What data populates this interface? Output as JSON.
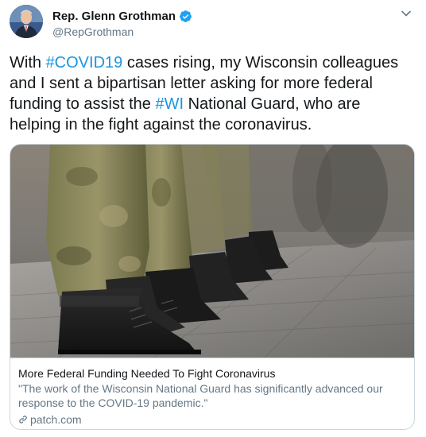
{
  "author": {
    "name": "Rep. Glenn Grothman",
    "handle": "@RepGrothman",
    "verified": true
  },
  "tweet": {
    "text_parts": [
      {
        "text": "With ",
        "type": "text"
      },
      {
        "text": "#COVID19",
        "type": "hashtag"
      },
      {
        "text": " cases rising, my Wisconsin colleagues and I sent a bipartisan letter asking for more federal funding to assist the ",
        "type": "text"
      },
      {
        "text": "#WI",
        "type": "hashtag"
      },
      {
        "text": " National Guard, who are helping in the fight against the coronavirus.",
        "type": "text"
      }
    ]
  },
  "card": {
    "title": "More Federal Funding Needed To Fight Coronavirus",
    "description": "\"The work of the Wisconsin National Guard has significantly advanced our response to the COVID-19 pandemic.\"",
    "domain": "patch.com"
  },
  "colors": {
    "accent": "#1b95e0",
    "verified": "#1da1f2",
    "secondary_text": "#657786"
  }
}
